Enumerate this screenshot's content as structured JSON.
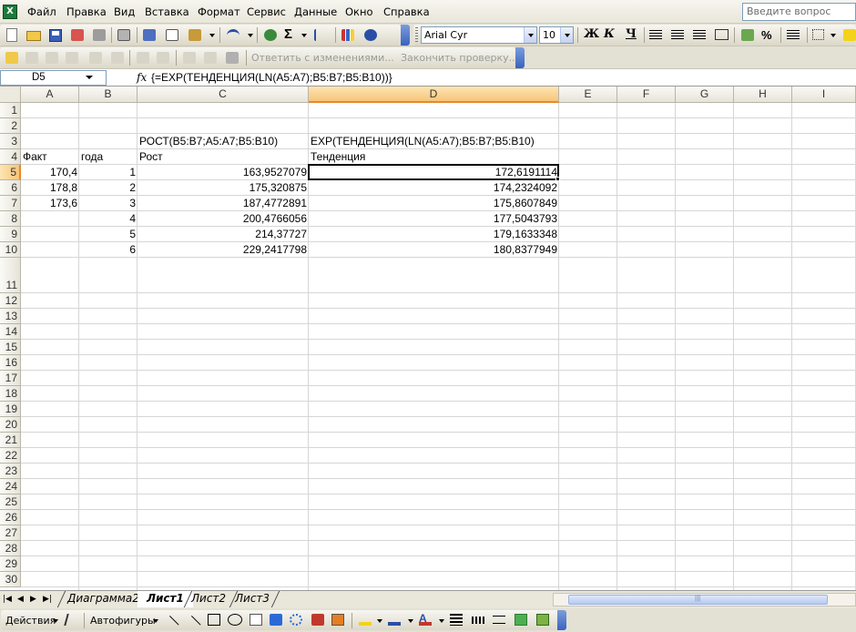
{
  "menu": {
    "app_icon": "excel-icon",
    "items": [
      "Файл",
      "Правка",
      "Вид",
      "Вставка",
      "Формат",
      "Сервис",
      "Данные",
      "Окно",
      "Справка"
    ],
    "help_placeholder": "Введите вопрос"
  },
  "toolbar": {
    "font_name": "Arial Cyr",
    "font_size": "10",
    "bold_label": "Ж",
    "italic_label": "К",
    "underline_label": "Ч",
    "sum_label": "Σ",
    "percent_label": "%",
    "reply_label": "Ответить с изменениями...",
    "end_review_label": "Закончить проверку..."
  },
  "formula_bar": {
    "cell_ref": "D5",
    "fx": "fx",
    "formula": "{=EXP(ТЕНДЕНЦИЯ(LN(A5:A7);B5:B7;B5:B10))}"
  },
  "grid": {
    "columns": [
      "A",
      "B",
      "C",
      "D",
      "E",
      "F",
      "G",
      "H",
      "I"
    ],
    "rows": [
      "1",
      "2",
      "3",
      "4",
      "5",
      "6",
      "7",
      "8",
      "9",
      "10",
      "11",
      "12",
      "13",
      "14",
      "15",
      "16",
      "17",
      "18",
      "19",
      "20",
      "21",
      "22",
      "23",
      "24",
      "25",
      "26",
      "27",
      "28",
      "29",
      "30"
    ],
    "selected_column": "D",
    "selected_row": "5",
    "cells": {
      "C3": "РОСТ(B5:B7;A5:A7;B5:B10)",
      "D3": "EXP(ТЕНДЕНЦИЯ(LN(A5:A7);B5:B7;B5:B10)",
      "A4": "Факт",
      "B4": "года",
      "C4": "Рост",
      "D4": "Тенденция",
      "A5": "170,4",
      "B5": "1",
      "C5": "163,9527079",
      "D5": "172,6191114",
      "A6": "178,8",
      "B6": "2",
      "C6": "175,320875",
      "D6": "174,2324092",
      "A7": "173,6",
      "B7": "3",
      "C7": "187,4772891",
      "D7": "175,8607849",
      "B8": "4",
      "C8": "200,4766056",
      "D8": "177,5043793",
      "B9": "5",
      "C9": "214,37727",
      "D9": "179,1633348",
      "B10": "6",
      "C10": "229,2417798",
      "D10": "180,8377949"
    }
  },
  "sheets": {
    "tabs": [
      "Диаграмма2",
      "Лист1",
      "Лист2",
      "Лист3"
    ],
    "active": "Лист1"
  },
  "drawing_toolbar": {
    "actions_label": "Действия",
    "autoshapes_label": "Автофигуры"
  },
  "colors": {
    "selected_header": "#f7c47a",
    "header_bg": "#e6e3d8",
    "toolbar_bg": "#e3e0d4",
    "accent_blue": "#3962c0"
  }
}
